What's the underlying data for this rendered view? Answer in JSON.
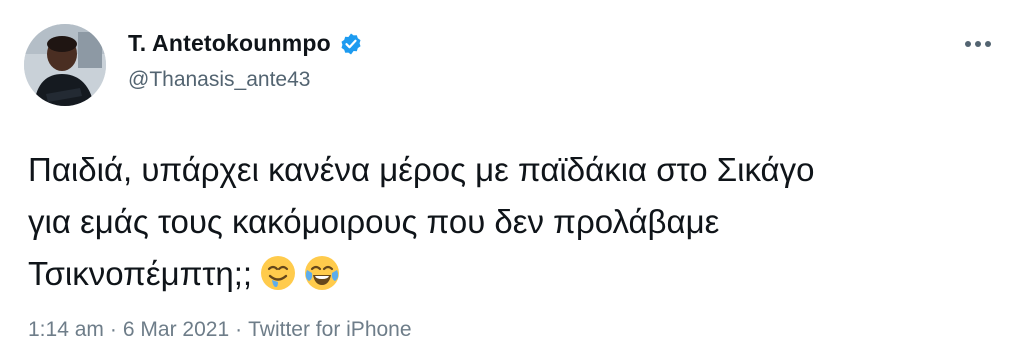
{
  "author": {
    "display_name": "T. Antetokounmpo",
    "handle": "@Thanasis_ante43",
    "verified": true,
    "avatar_icon": "profile-photo"
  },
  "actions": {
    "more_icon": "more-options-icon"
  },
  "tweet": {
    "lines": [
      "Παιδιά, υπάρχει κανένα μέρος με παϊδάκια στο Σικάγο",
      "για εμάς τους κακόμοιρους που δεν προλάβαμε",
      "Τσικνοπέμπτη;;"
    ],
    "emojis": [
      "drooling-face-emoji",
      "tears-of-joy-emoji"
    ]
  },
  "meta": {
    "time": "1:14 am",
    "separator": "·",
    "date": "6 Mar 2021",
    "source": "Twitter for iPhone"
  },
  "colors": {
    "text": "#0f1419",
    "secondary": "#536471",
    "verified": "#1d9bf0"
  }
}
